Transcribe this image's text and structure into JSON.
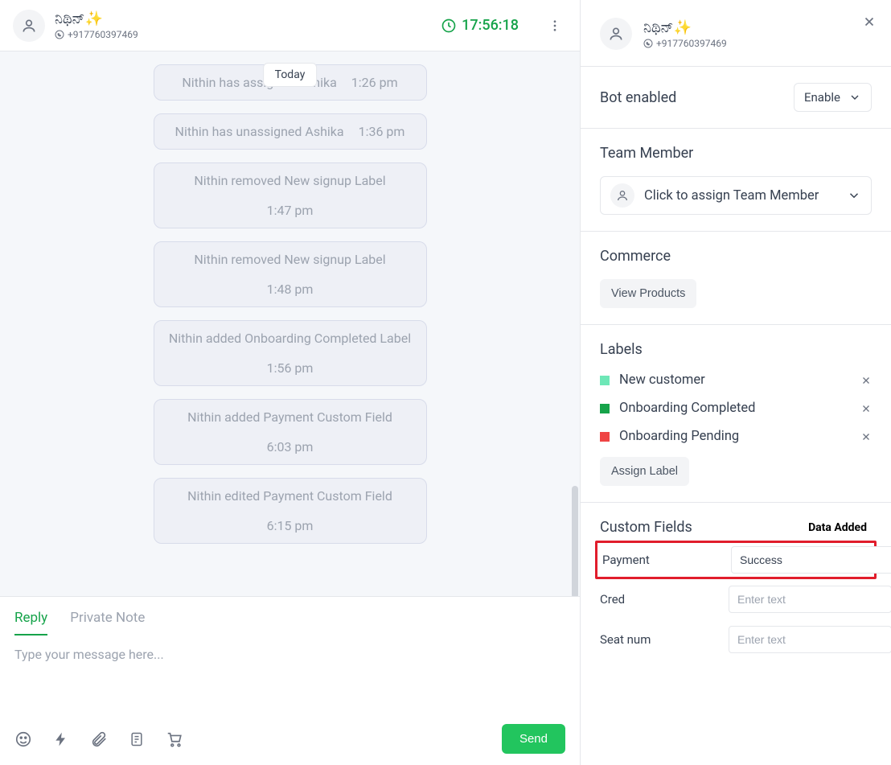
{
  "header": {
    "contact_name": "ನಿಥಿನ್✨",
    "contact_phone": "+917760397469",
    "timer": "17:56:18"
  },
  "messages": {
    "date_chip": "Today",
    "items": [
      {
        "text": "Nithin has assigned Ashika",
        "time": "1:26 pm"
      },
      {
        "text": "Nithin has unassigned Ashika",
        "time": "1:36 pm"
      },
      {
        "text": "Nithin removed New signup Label",
        "time": "1:47 pm"
      },
      {
        "text": "Nithin removed New signup Label",
        "time": "1:48 pm"
      },
      {
        "text": "Nithin added Onboarding Completed Label",
        "time": "1:56 pm"
      },
      {
        "text": "Nithin added Payment Custom Field",
        "time": "6:03 pm"
      },
      {
        "text": "Nithin edited Payment Custom Field",
        "time": "6:15 pm"
      }
    ]
  },
  "compose": {
    "tab_reply": "Reply",
    "tab_note": "Private Note",
    "placeholder": "Type your message here...",
    "send": "Send"
  },
  "sidebar": {
    "contact_name": "ನಿಥಿನ್✨",
    "contact_phone": "+917760397469",
    "bot_label": "Bot enabled",
    "bot_select": "Enable",
    "team_heading": "Team Member",
    "team_assign": "Click to assign Team Member",
    "commerce_heading": "Commerce",
    "view_products": "View Products",
    "labels_heading": "Labels",
    "labels": [
      {
        "color": "#6ee7b7",
        "text": "New customer"
      },
      {
        "color": "#16a34a",
        "text": "Onboarding Completed"
      },
      {
        "color": "#ef4444",
        "text": "Onboarding Pending"
      }
    ],
    "assign_label": "Assign Label",
    "custom_fields_heading": "Custom Fields",
    "data_added_annot": "Data Added",
    "cf": [
      {
        "label": "Payment",
        "value": "Success",
        "placeholder": "",
        "highlight": true
      },
      {
        "label": "Cred",
        "value": "",
        "placeholder": "Enter text",
        "highlight": false
      },
      {
        "label": "Seat num",
        "value": "",
        "placeholder": "Enter text",
        "highlight": false
      }
    ]
  }
}
